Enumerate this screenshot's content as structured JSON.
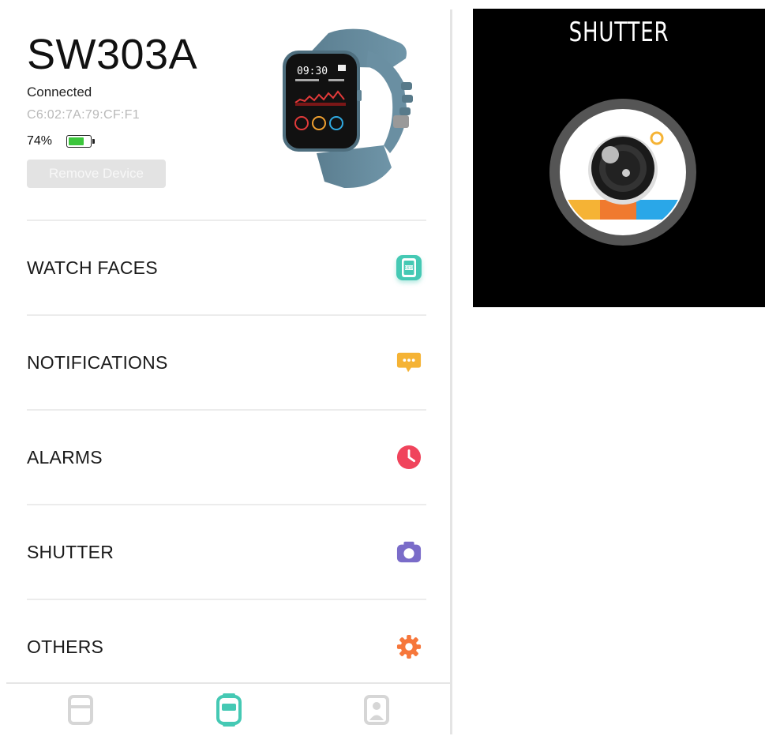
{
  "device": {
    "name": "SW303A",
    "status": "Connected",
    "mac": "C6:02:7A:79:CF:F1",
    "battery_percent_text": "74%",
    "battery_level": 0.74,
    "remove_label": "Remove Device",
    "watch_time": "09:30"
  },
  "menu": {
    "items": [
      {
        "label": "WATCH FACES",
        "icon": "watch-face-icon",
        "color": "#45c9b4"
      },
      {
        "label": "NOTIFICATIONS",
        "icon": "message-icon",
        "color": "#f5b335"
      },
      {
        "label": "ALARMS",
        "icon": "clock-icon",
        "color": "#f0445c"
      },
      {
        "label": "SHUTTER",
        "icon": "camera-icon",
        "color": "#7a6cc9"
      },
      {
        "label": "OTHERS",
        "icon": "gear-icon",
        "color": "#f6773b"
      }
    ]
  },
  "tabs": [
    {
      "name": "tab-data",
      "icon": "card-icon",
      "active": false
    },
    {
      "name": "tab-device",
      "icon": "watch-icon",
      "active": true,
      "color": "#45c9b4"
    },
    {
      "name": "tab-profile",
      "icon": "person-icon",
      "active": false
    }
  ],
  "watch_screen": {
    "title": "SHUTTER"
  },
  "colors": {
    "accent": "#45c9b4",
    "battery": "#3cc63c"
  }
}
